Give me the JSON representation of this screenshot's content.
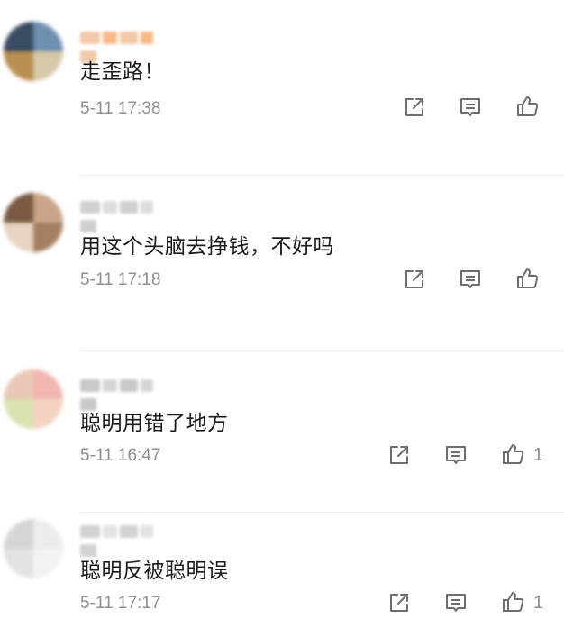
{
  "comments": [
    {
      "text": "走歪路！",
      "time": "5-11 17:38",
      "likes": "",
      "avatar_colors": [
        "#3a4c63",
        "#6f8fb0",
        "#b98f52",
        "#d6c9a9"
      ],
      "name_colors": [
        "#f2c9a8",
        "#f6b98a"
      ]
    },
    {
      "text": "用这个头脑去挣钱，不好吗",
      "time": "5-11 17:18",
      "likes": "",
      "avatar_colors": [
        "#7a5a42",
        "#c9a48a",
        "#e6d3c2",
        "#a57f60"
      ],
      "name_colors": [
        "#cfcfcf",
        "#dcdcdc"
      ]
    },
    {
      "text": "聪明用错了地方",
      "time": "5-11 16:47",
      "likes": "1",
      "avatar_colors": [
        "#e9c7b5",
        "#f2b6b0",
        "#d8e3b0",
        "#f3d3c0"
      ],
      "name_colors": [
        "#c8c8c8",
        "#d6d6d6"
      ]
    },
    {
      "text": "聪明反被聪明误",
      "time": "5-11 17:17",
      "likes": "1",
      "avatar_colors": [
        "#d5d5d5",
        "#ececec",
        "#e2e2e2",
        "#f2f2f2"
      ],
      "name_colors": [
        "#d2d2d2",
        "#e2e2e2"
      ]
    }
  ],
  "icons": {
    "share": "share-icon",
    "reply": "comment-icon",
    "like": "thumbs-up-icon"
  },
  "colors": {
    "text": "#1a1a1a",
    "meta": "#8f8f8f",
    "icon": "#6e6e6e"
  }
}
